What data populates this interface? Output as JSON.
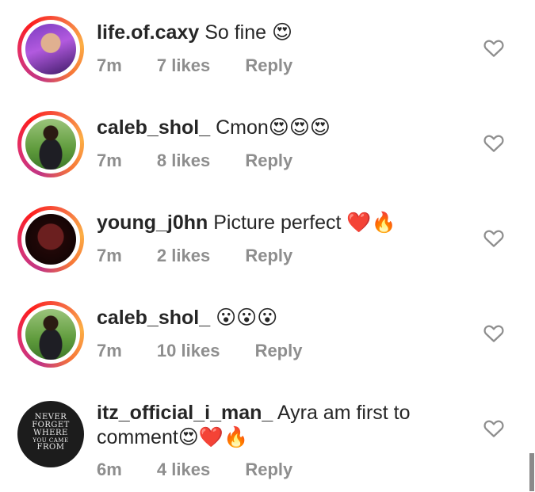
{
  "comments": [
    {
      "username": "life.of.caxy",
      "text": "So fine 😍",
      "time": "7m",
      "likes": "7 likes",
      "reply": "Reply",
      "avatar_ring": true,
      "heart_icon": "heart-outline-icon"
    },
    {
      "username": "caleb_shol_",
      "text": "Cmon😍😍😍",
      "time": "7m",
      "likes": "8 likes",
      "reply": "Reply",
      "avatar_ring": true,
      "heart_icon": "heart-outline-icon"
    },
    {
      "username": "young_j0hn",
      "text": "Picture perfect ❤️🔥",
      "time": "7m",
      "likes": "2 likes",
      "reply": "Reply",
      "avatar_ring": true,
      "heart_icon": "heart-outline-icon"
    },
    {
      "username": "caleb_shol_",
      "text": "😮😮😮",
      "time": "7m",
      "likes": "10 likes",
      "reply": "Reply",
      "avatar_ring": true,
      "heart_icon": "heart-outline-icon"
    },
    {
      "username": "itz_official_i_man_",
      "text": "Ayra am first to comment😍❤️🔥",
      "time": "6m",
      "likes": "4 likes",
      "reply": "Reply",
      "avatar_ring": false,
      "avatar_text": [
        "NEVER",
        "FORGET",
        "WHERE",
        "YOU CAME",
        "FROM"
      ],
      "heart_icon": "heart-outline-icon"
    }
  ],
  "colors": {
    "text": "#262626",
    "meta": "#8e8e8e",
    "ring_start": "#c13584",
    "ring_end": "#fcaf45"
  }
}
